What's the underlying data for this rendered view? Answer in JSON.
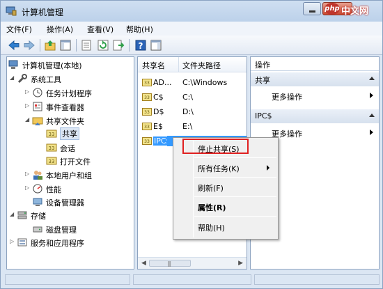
{
  "window": {
    "title": "计算机管理"
  },
  "watermark": {
    "badge": "php",
    "text": "中文网"
  },
  "menu": [
    "文件(F)",
    "操作(A)",
    "查看(V)",
    "帮助(H)"
  ],
  "toolbar_icons": [
    "back-arrow-icon",
    "forward-arrow-icon",
    "up-folder-icon",
    "show-hide-tree-icon",
    "properties-icon",
    "refresh-icon",
    "export-list-icon",
    "help-icon",
    "show-hide-action-pane-icon"
  ],
  "tree": [
    {
      "label": "计算机管理(本地)",
      "icon": "computer-management-icon",
      "level": 0,
      "arrow": ""
    },
    {
      "label": "系统工具",
      "icon": "system-tools-icon",
      "level": 1,
      "arrow": "expanded"
    },
    {
      "label": "任务计划程序",
      "icon": "clock-icon",
      "level": 2,
      "arrow": "collapsed"
    },
    {
      "label": "事件查看器",
      "icon": "event-viewer-icon",
      "level": 2,
      "arrow": "collapsed"
    },
    {
      "label": "共享文件夹",
      "icon": "shared-folder-icon",
      "level": 2,
      "arrow": "expanded"
    },
    {
      "label": "共享",
      "icon": "shares-icon",
      "level": 3,
      "arrow": "",
      "selected": true
    },
    {
      "label": "会话",
      "icon": "sessions-icon",
      "level": 3,
      "arrow": ""
    },
    {
      "label": "打开文件",
      "icon": "open-files-icon",
      "level": 3,
      "arrow": ""
    },
    {
      "label": "本地用户和组",
      "icon": "users-groups-icon",
      "level": 2,
      "arrow": "collapsed"
    },
    {
      "label": "性能",
      "icon": "performance-icon",
      "level": 2,
      "arrow": "collapsed"
    },
    {
      "label": "设备管理器",
      "icon": "device-manager-icon",
      "level": 2,
      "arrow": ""
    },
    {
      "label": "存储",
      "icon": "storage-icon",
      "level": 1,
      "arrow": "expanded"
    },
    {
      "label": "磁盘管理",
      "icon": "disk-management-icon",
      "level": 2,
      "arrow": ""
    },
    {
      "label": "服务和应用程序",
      "icon": "services-apps-icon",
      "level": 1,
      "arrow": "collapsed"
    }
  ],
  "list": {
    "columns": [
      "共享名",
      "文件夹路径"
    ],
    "rows": [
      {
        "name": "AD...",
        "path": "C:\\Windows"
      },
      {
        "name": "C$",
        "path": "C:\\"
      },
      {
        "name": "D$",
        "path": "D:\\"
      },
      {
        "name": "E$",
        "path": "E:\\"
      },
      {
        "name": "IPC$",
        "path": "",
        "selected": true
      }
    ]
  },
  "actions": {
    "header": "操作",
    "sections": [
      {
        "title": "共享",
        "item": "更多操作"
      },
      {
        "title": "IPC$",
        "item": "更多操作"
      }
    ]
  },
  "context_menu": {
    "items": [
      {
        "label": "停止共享(S)",
        "highlighted": true
      },
      {
        "label": "所有任务(K)",
        "submenu": true
      },
      {
        "label": "刷新(F)"
      },
      {
        "label": "属性(R)",
        "bold": true
      },
      {
        "label": "帮助(H)"
      }
    ]
  },
  "colors": {
    "selection": "#3399ff",
    "highlight_box": "#e02020",
    "window_bg": "#dbe6f3"
  }
}
